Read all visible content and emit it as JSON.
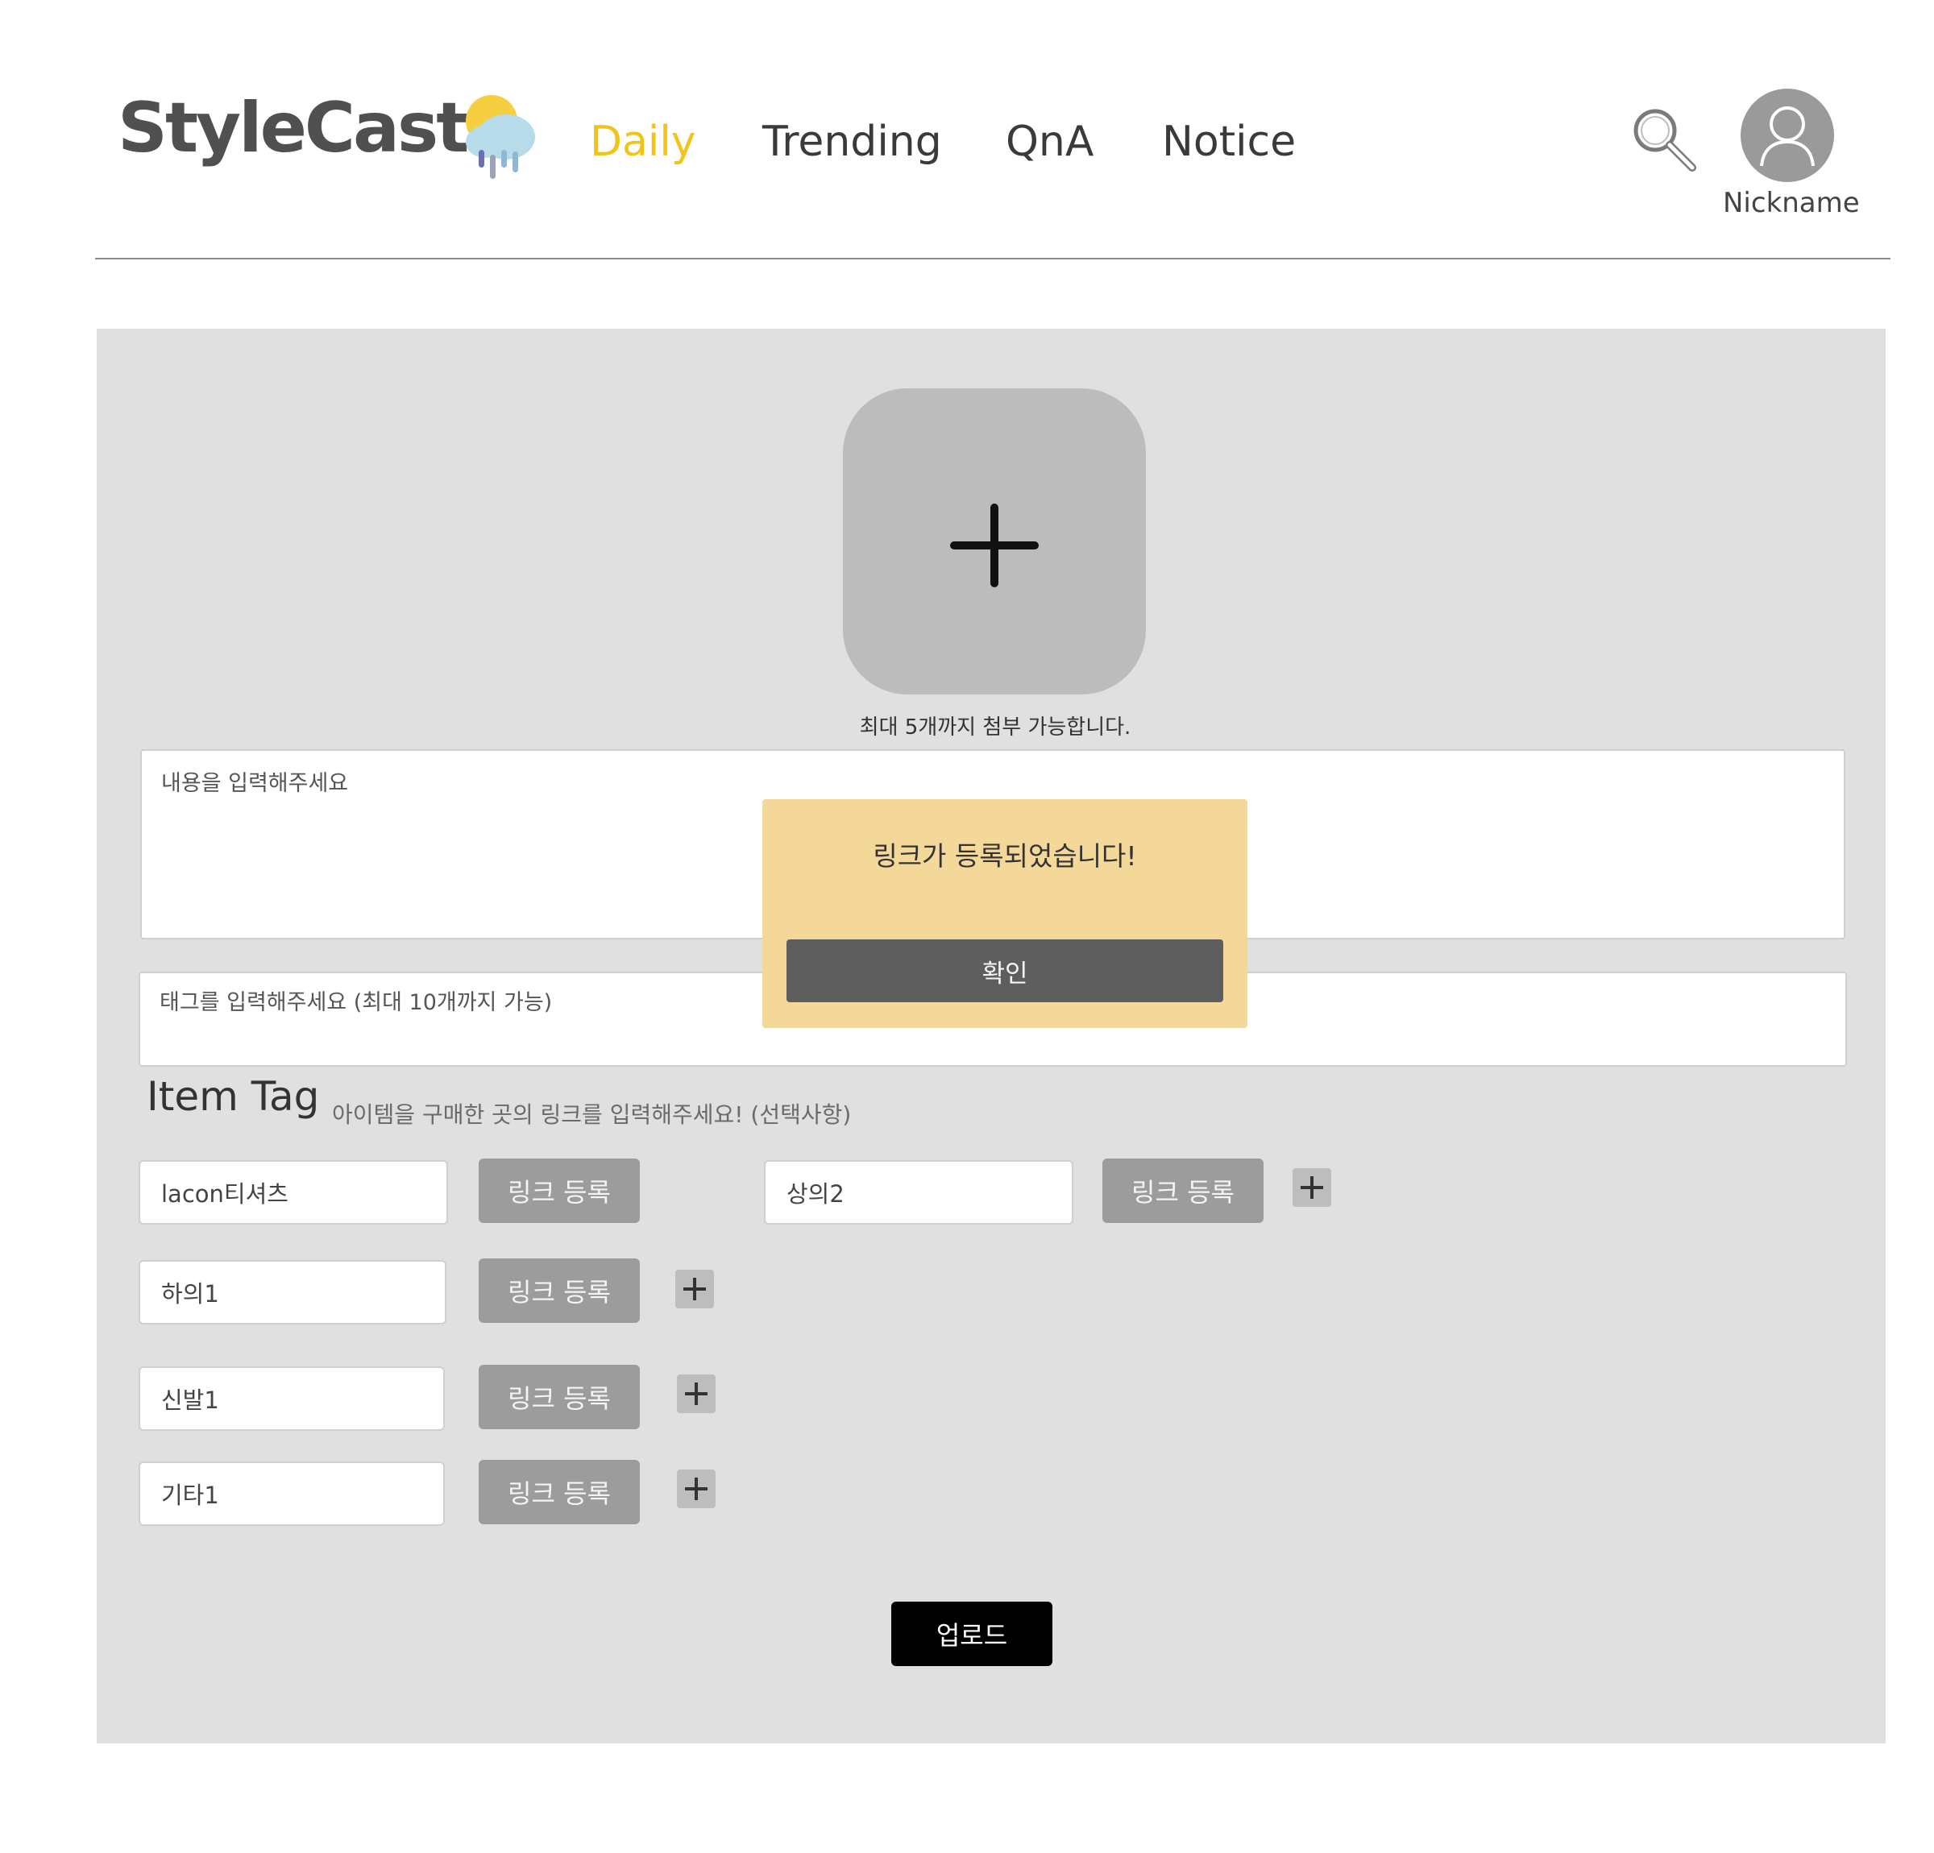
{
  "header": {
    "logo_text": "StyleCast",
    "nav": [
      {
        "label": "Daily",
        "active": true
      },
      {
        "label": "Trending",
        "active": false
      },
      {
        "label": "QnA",
        "active": false
      },
      {
        "label": "Notice",
        "active": false
      }
    ],
    "user": {
      "nickname": "Nickname"
    }
  },
  "form": {
    "upload_hint": "최대 5개까지 첨부 가능합니다.",
    "content_placeholder": "내용을 입력해주세요",
    "tag_placeholder": "태그를 입력해주세요 (최대 10개까지 가능)",
    "item_tag_title": "Item Tag",
    "item_tag_subtitle": "아이템을 구매한 곳의 링크를 입력해주세요! (선택사항)",
    "link_button_label": "링크 등록",
    "items": [
      {
        "value": "lacon티셔츠"
      },
      {
        "value": "상의2"
      },
      {
        "value": "하의1"
      },
      {
        "value": "신발1"
      },
      {
        "value": "기타1"
      }
    ],
    "upload_button_label": "업로드"
  },
  "modal": {
    "message": "링크가 등록되었습니다!",
    "confirm_label": "확인"
  },
  "colors": {
    "accent": "#f2c318",
    "panel": "#e0e0e0",
    "modal_bg": "#f4d89a",
    "button_gray": "#9c9c9c"
  }
}
